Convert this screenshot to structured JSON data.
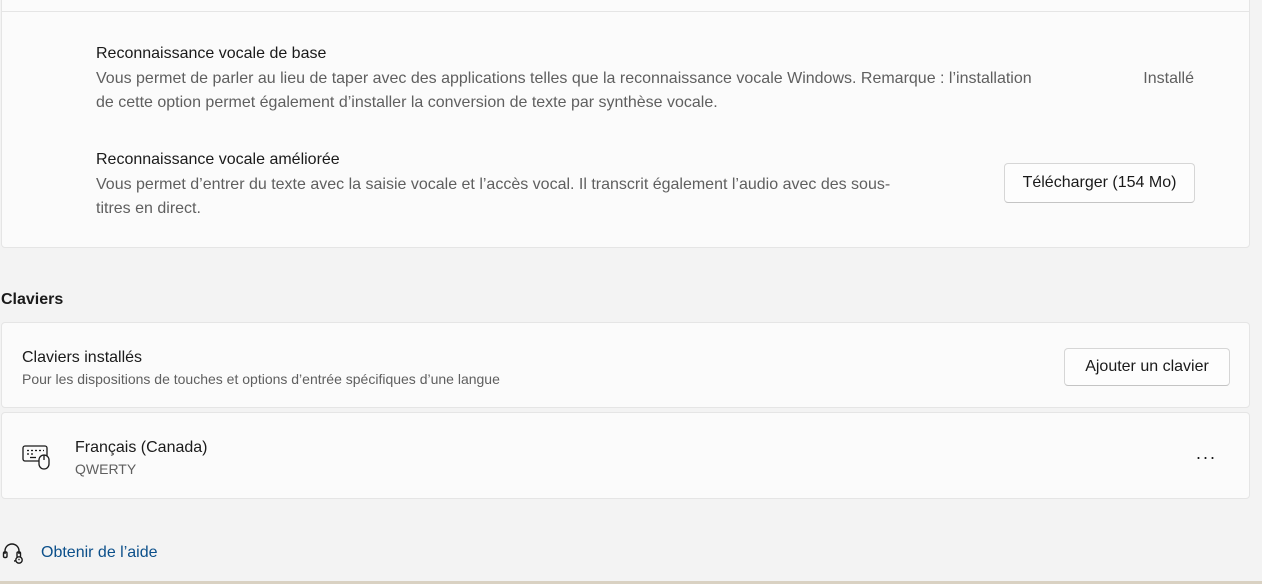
{
  "speech": {
    "basic": {
      "title": "Reconnaissance vocale de base",
      "desc_line1": "Vous permet de parler au lieu de taper avec des applications telles que la reconnaissance vocale Windows. Remarque : l’installation",
      "desc_line2": "de cette option permet également d’installer la conversion de texte par synthèse vocale.",
      "status": "Installé"
    },
    "enhanced": {
      "title": "Reconnaissance vocale améliorée",
      "desc_line1": "Vous permet d’entrer du texte avec la saisie vocale et l’accès vocal. Il transcrit également l’audio avec des sous-",
      "desc_line2": "titres en direct.",
      "button_label": "Télécharger (154 Mo)"
    }
  },
  "keyboards": {
    "section_title": "Claviers",
    "installed_title": "Claviers installés",
    "installed_desc": "Pour les dispositions de touches et options d’entrée spécifiques d’une langue",
    "add_button_label": "Ajouter un clavier",
    "items": [
      {
        "name": "Français (Canada)",
        "layout": "QWERTY",
        "icon": "keyboard-icon",
        "more_label": "···"
      }
    ]
  },
  "help": {
    "icon": "help-headset-icon",
    "link_label": "Obtenir de l’aide"
  },
  "colors": {
    "background": "#f3f3f3",
    "card": "#fbfbfb",
    "link": "#0b4f8a"
  }
}
